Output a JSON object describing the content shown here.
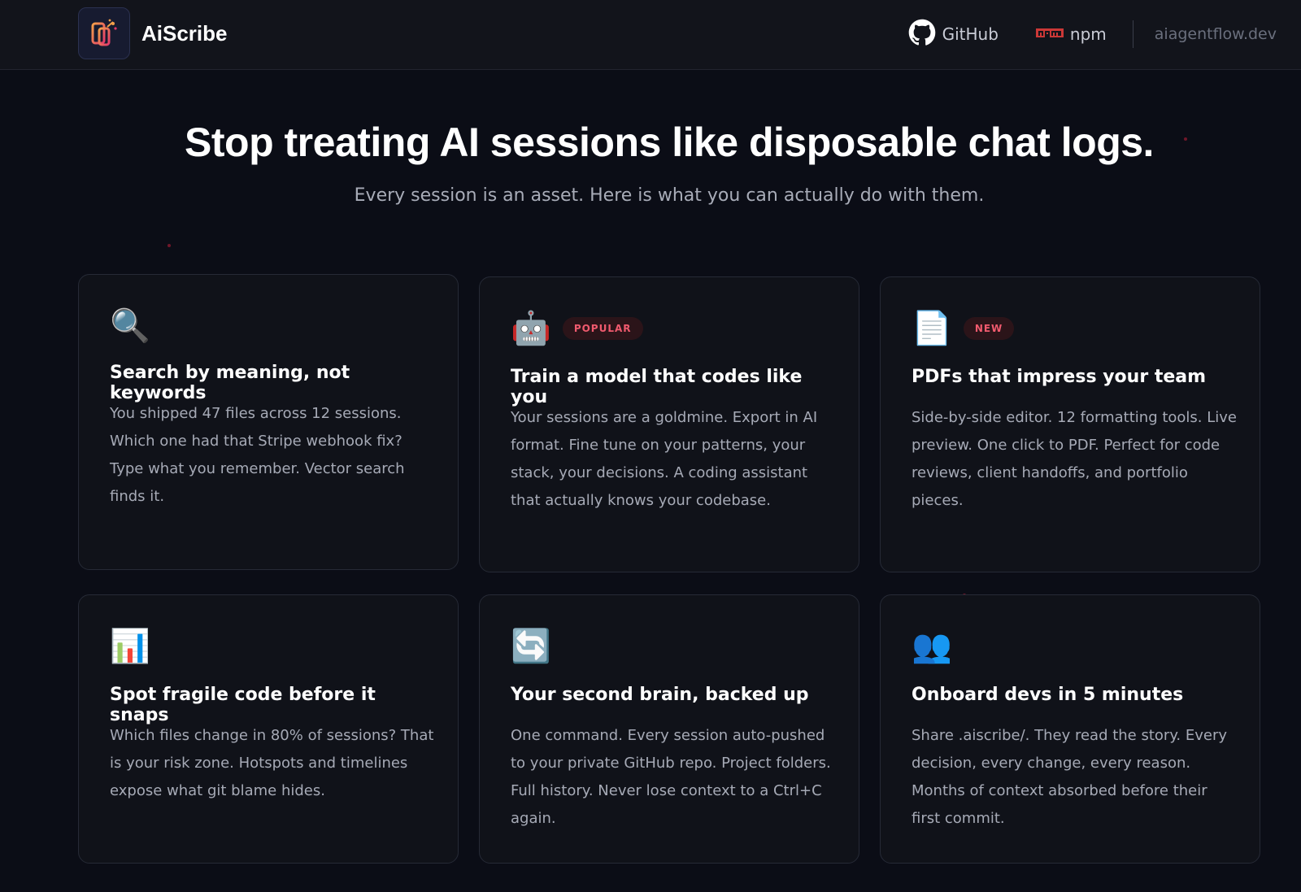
{
  "header": {
    "brand": "AiScribe",
    "nav": {
      "github": "GitHub",
      "npm": "npm",
      "site": "aiagentflow.dev"
    }
  },
  "hero": {
    "title": "Stop treating AI sessions like disposable chat logs.",
    "subtitle": "Every session is an asset. Here is what you can actually do with them."
  },
  "cards": [
    {
      "icon": "🔍",
      "icon_name": "magnifier-icon",
      "badge": "",
      "title": "Search by meaning, not keywords",
      "description": "You shipped 47 files across 12 sessions. Which one had that Stripe webhook fix? Type what you remember. Vector search finds it."
    },
    {
      "icon": "🤖",
      "icon_name": "robot-icon",
      "badge": "POPULAR",
      "title": "Train a model that codes like you",
      "description": "Your sessions are a goldmine. Export in AI format. Fine tune on your patterns, your stack, your decisions. A coding assistant that actually knows your codebase."
    },
    {
      "icon": "📄",
      "icon_name": "document-icon",
      "badge": "NEW",
      "title": "PDFs that impress your team",
      "description": "Side-by-side editor. 12 formatting tools. Live preview. One click to PDF. Perfect for code reviews, client handoffs, and portfolio pieces."
    },
    {
      "icon": "📊",
      "icon_name": "bar-chart-icon",
      "badge": "",
      "title": "Spot fragile code before it snaps",
      "description": "Which files change in 80% of sessions? That is your risk zone. Hotspots and timelines expose what git blame hides."
    },
    {
      "icon": "🔄",
      "icon_name": "sync-icon",
      "badge": "",
      "title": "Your second brain, backed up",
      "description": "One command. Every session auto-pushed to your private GitHub repo. Project folders. Full history. Never lose context to a Ctrl+C again."
    },
    {
      "icon": "👥",
      "icon_name": "people-icon",
      "badge": "",
      "title": "Onboard devs in 5 minutes",
      "description": "Share .aiscribe/. They read the story. Every decision, every change, every reason. Months of context absorbed before their first commit."
    }
  ],
  "colors": {
    "background": "#0b0d16",
    "card": "#101219",
    "accent_red": "#f05a6e",
    "npm_red": "#cb3837"
  }
}
